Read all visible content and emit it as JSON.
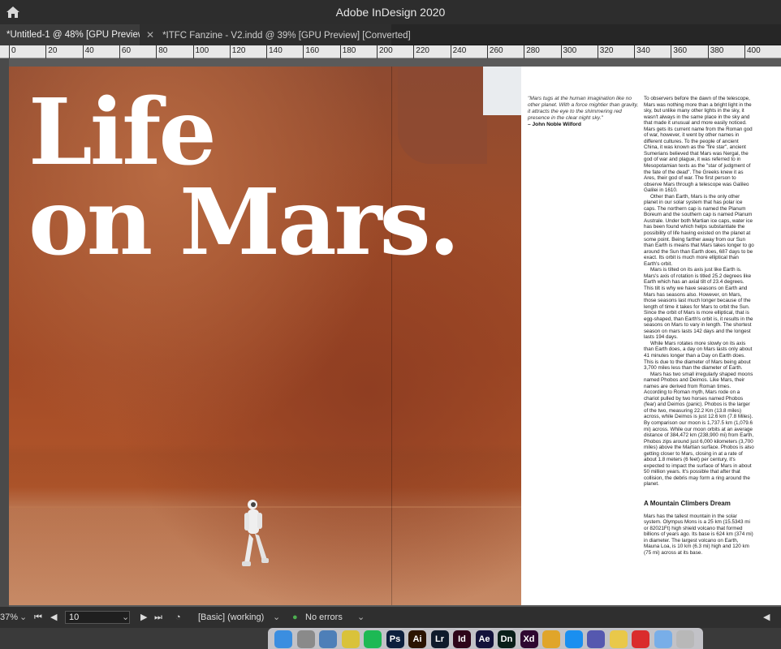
{
  "app": {
    "title": "Adobe InDesign 2020"
  },
  "tabs": [
    {
      "label": "*Untitled-1 @ 48% [GPU Preview]",
      "active": true
    },
    {
      "label": "*ITFC Fanzine - V2.indd @ 39% [GPU Preview] [Converted]",
      "active": false
    }
  ],
  "ruler": {
    "ticks": [
      "0",
      "20",
      "40",
      "60",
      "80",
      "100",
      "120",
      "140",
      "160",
      "180",
      "200",
      "220",
      "240",
      "260",
      "280",
      "300",
      "320",
      "340",
      "360",
      "380",
      "400"
    ]
  },
  "document": {
    "headline_line1": "Life",
    "headline_line2": "on Mars.",
    "quote": "\"Mars tugs at the human imagination like no other planet. With a force mightier than gravity, it attracts the eye to the shimmering red presence in the clear night sky.\"",
    "quote_author": "– John Noble Wilford",
    "paragraphs": [
      "To observers before the dawn of the telescope, Mars was nothing more than a bright light in the sky, but unlike many other lights in the sky, it wasn't always in the same place in the sky and that made it unusual and more easily noticed. Mars gets its current name from the Roman god of war, however, it went by other names in different cultures. To the people of ancient China, it was known as the \"fire star\", ancient Sumerians believed that Mars was Nergal, the god of war and plague, it was referred to in Mesopotamian texts as the \"star of judgment of the fate of the dead\". The Greeks knew it as Ares, their god of war. The first person to observe Mars through a telescope was Galileo Galilei in 1610.",
      "Other than Earth, Mars is the only other planet in our solar system that has polar ice caps. The northern cap is named the Planum Boreum and the southern cap is named Planum Australe. Under both Martian ice caps, water ice has been found which helps substantiate the possibility of life having existed on the planet at some point. Being farther away from our Sun than Earth is means that Mars takes longer to go around the Sun than Earth does, 687 days to be exact. Its orbit is much more elliptical than Earth's orbit.",
      "Mars is tilted on its axis just like Earth is. Mars's axis of rotation is titled 25.2 degrees like Earth which has an axial tilt of 23.4 degrees. This tilt is why we have seasons on Earth and Mars has seasons also. However, on Mars, those seasons last much longer because of the length of time it takes for Mars to orbit the Sun. Since the orbit of Mars is more elliptical, that is egg-shaped, than Earth's orbit is, it results in the seasons on Mars to vary in length. The shortest season on mars lasts 142 days and the longest lasts 194 days.",
      "While Mars rotates more slowly on its axis than Earth does, a day on Mars lasts only about 41 minutes longer than a Day on Earth does. This is due to the diameter of Mars being about 3,700 miles less than the diameter of Earth.",
      "Mars has two small irregularly shaped moons named Phobos and Deimos. Like Mars, their names are derived from Roman times. According to Roman myth, Mars rode on a chariot pulled by two horses named Phobos (fear) and Deimos (panic). Phobos is the larger of the two, measuring 22.2 Km (13.8 miles) across, while Deimos is just 12.6 km (7.8 Miles). By comparison our moon is 1,737.5 km (1,079.6 mi) across. While our moon orbits at an average distance of 384,472 km (238,900 mi) from Earth, Phobos zips around just 6,000 kilometers (3,700 miles) above the Martian surface. Phobos is also getting closer to Mars, closing in at a rate of about 1.8 meters (6 feet) per century, it's expected to impact the surface of Mars in about 50 million years. It's possible that after that collision, the debris may form a ring around the planet."
    ],
    "subheading": "A Mountain Climbers Dream",
    "subparagraph": "Mars has the tallest mountain in the solar system. Olympus Mons is a 25 km (15.5343 mi or 82021Ft) high shield volcano that formed billions of years ago. Its base is 624 km (374 mi) in diameter. The largest volcano on Earth, Mauna Loa, is 10 km (6.3 mi) high and 120 km (75 mi) across at its base."
  },
  "status": {
    "zoom": "37%",
    "page": "10",
    "profile": "[Basic] (working)",
    "preflight": "No errors"
  },
  "dock": {
    "apps": [
      {
        "name": "Finder",
        "label": "",
        "color": "#3b8ee0"
      },
      {
        "name": "Launchpad",
        "label": "",
        "color": "#8a8a8a"
      },
      {
        "name": "Preview",
        "label": "",
        "color": "#4e7fb8"
      },
      {
        "name": "Photos",
        "label": "",
        "color": "#d9c23a"
      },
      {
        "name": "Spotify",
        "label": "",
        "color": "#1db954"
      },
      {
        "name": "Photoshop",
        "label": "Ps",
        "color": "#0d1f3c"
      },
      {
        "name": "Illustrator",
        "label": "Ai",
        "color": "#2b1400"
      },
      {
        "name": "Lightroom",
        "label": "Lr",
        "color": "#0f1b2b"
      },
      {
        "name": "InDesign",
        "label": "Id",
        "color": "#2e0519"
      },
      {
        "name": "After Effects",
        "label": "Ae",
        "color": "#13123a"
      },
      {
        "name": "Dimension",
        "label": "Dn",
        "color": "#0a1f19"
      },
      {
        "name": "XD",
        "label": "Xd",
        "color": "#2e0730"
      },
      {
        "name": "Chrome",
        "label": "",
        "color": "#e0a52a"
      },
      {
        "name": "App Store",
        "label": "",
        "color": "#1a8ff0"
      },
      {
        "name": "Teams",
        "label": "",
        "color": "#5558af"
      },
      {
        "name": "Notes",
        "label": "",
        "color": "#e9c84a"
      },
      {
        "name": "Creative Cloud",
        "label": "",
        "color": "#da2c2c"
      },
      {
        "name": "Folder",
        "label": "",
        "color": "#78aee8"
      },
      {
        "name": "Trash",
        "label": "",
        "color": "#b8b8b8"
      }
    ]
  }
}
